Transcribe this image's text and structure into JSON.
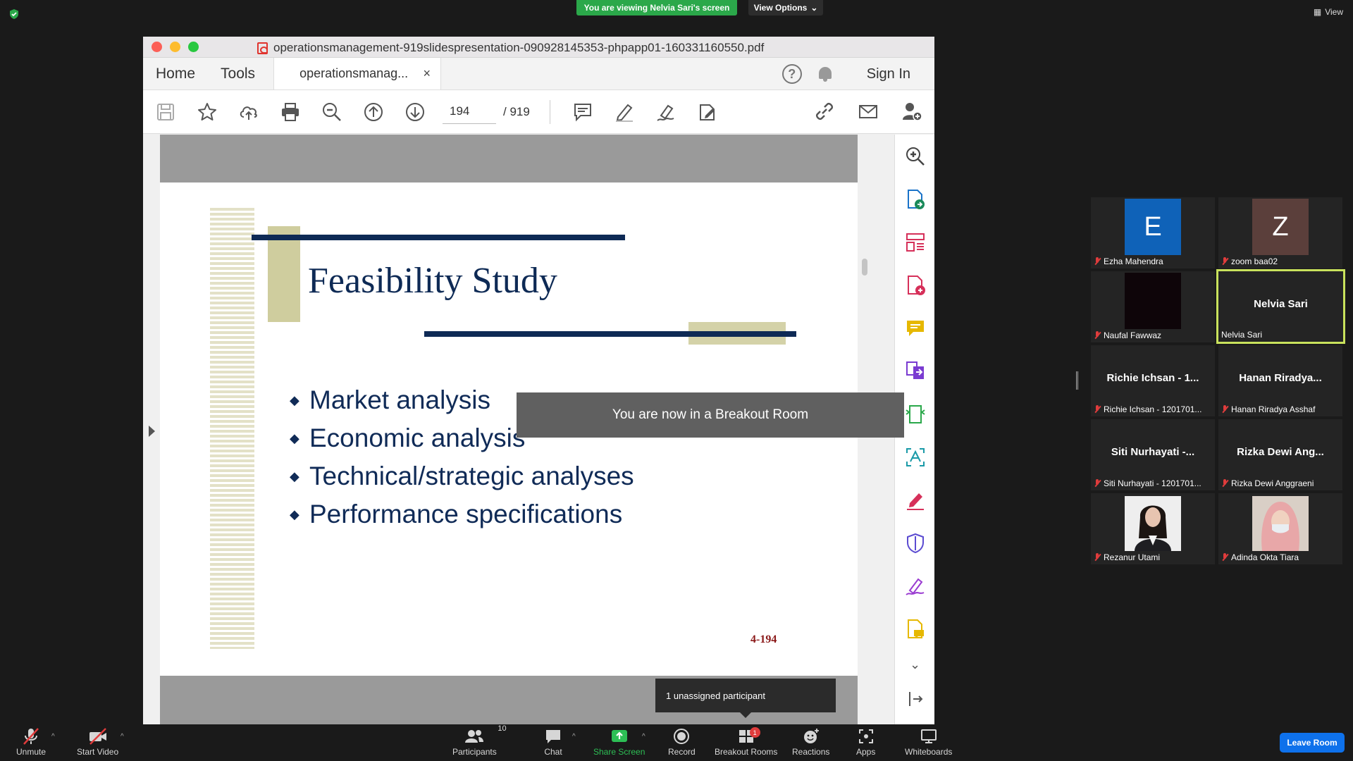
{
  "banner": {
    "viewing_text": "You are viewing Nelvia Sari's screen",
    "view_options_label": "View Options",
    "view_label": "View"
  },
  "pdf_window": {
    "title": "operationsmanagement-919slidespresentation-090928145353-phpapp01-160331160550.pdf",
    "tabs": {
      "home": "Home",
      "tools": "Tools",
      "doc_tab": "operationsmanag...",
      "close": "×"
    },
    "help_glyph": "?",
    "sign_in": "Sign In",
    "page_current": "194",
    "page_total": "/ 919"
  },
  "slide": {
    "title": "Feasibility Study",
    "bullets": [
      "Market analysis",
      "Economic analysis",
      "Technical/strategic analyses",
      "Performance specifications"
    ],
    "bullet_glyph": "◆",
    "page_number": "4-194"
  },
  "notifications": {
    "breakout_toast": "You are now in a Breakout Room",
    "unassigned": "1 unassigned participant"
  },
  "participants": [
    {
      "display": "E",
      "label": "Ezha Mahendra",
      "avatar_color": "#0f62b8",
      "type": "letter"
    },
    {
      "display": "Z",
      "label": "zoom baa02",
      "avatar_color": "#5b3f3b",
      "type": "letter"
    },
    {
      "display": "",
      "label": "Naufal Fawwaz",
      "avatar_color": "#0e0509",
      "type": "video"
    },
    {
      "display": "Nelvia Sari",
      "label": "Nelvia Sari",
      "type": "name",
      "active": true
    },
    {
      "display": "Richie Ichsan - 1...",
      "label": "Richie Ichsan - 1201701...",
      "type": "name"
    },
    {
      "display": "Hanan  Riradya...",
      "label": "Hanan Riradya Asshaf",
      "type": "name"
    },
    {
      "display": "Siti Nurhayati -...",
      "label": "Siti Nurhayati - 1201701...",
      "type": "name"
    },
    {
      "display": "Rizka Dewi Ang...",
      "label": "Rizka Dewi Anggraeni",
      "type": "name"
    },
    {
      "display": "",
      "label": "Rezanur Utami",
      "type": "photo",
      "photo": "woman-blazer"
    },
    {
      "display": "",
      "label": "Adinda Okta Tiara",
      "type": "photo",
      "photo": "woman-hijab"
    }
  ],
  "bottom_bar": {
    "unmute": "Unmute",
    "start_video": "Start Video",
    "participants": "Participants",
    "participants_count": "10",
    "chat": "Chat",
    "share_screen": "Share Screen",
    "record": "Record",
    "breakout_rooms": "Breakout Rooms",
    "breakout_badge": "1",
    "reactions": "Reactions",
    "apps": "Apps",
    "whiteboards": "Whiteboards",
    "leave_room": "Leave Room"
  },
  "colors": {
    "banner_green": "#2ba84a",
    "slide_navy": "#0e2a55",
    "slide_tan": "#cfcd9e",
    "active_speaker": "#c9e25c",
    "leave_blue": "#0e71eb"
  }
}
